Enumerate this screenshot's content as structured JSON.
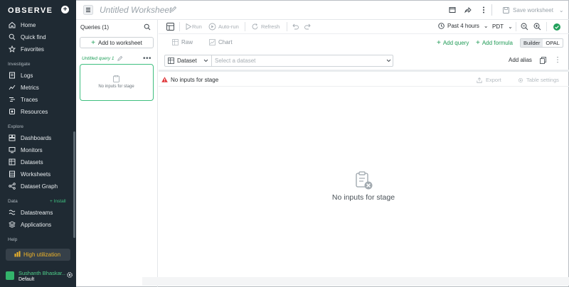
{
  "app": {
    "logo": "OBSERVE"
  },
  "sidebar": {
    "top_items": [
      {
        "label": "Home",
        "icon": "home-icon"
      },
      {
        "label": "Quick find",
        "icon": "search-icon"
      },
      {
        "label": "Favorites",
        "icon": "star-icon"
      }
    ],
    "sections": {
      "investigate": "Investigate",
      "explore": "Explore",
      "data": "Data",
      "help": "Help"
    },
    "investigate_items": [
      {
        "label": "Logs",
        "icon": "logs-icon"
      },
      {
        "label": "Metrics",
        "icon": "metrics-icon"
      },
      {
        "label": "Traces",
        "icon": "traces-icon"
      },
      {
        "label": "Resources",
        "icon": "resources-icon"
      }
    ],
    "explore_items": [
      {
        "label": "Dashboards",
        "icon": "dashboards-icon"
      },
      {
        "label": "Monitors",
        "icon": "monitors-icon"
      },
      {
        "label": "Datasets",
        "icon": "datasets-icon"
      },
      {
        "label": "Worksheets",
        "icon": "worksheets-icon"
      },
      {
        "label": "Dataset Graph",
        "icon": "graph-icon"
      }
    ],
    "data_items": [
      {
        "label": "Datastreams",
        "icon": "datastreams-icon"
      },
      {
        "label": "Applications",
        "icon": "applications-icon"
      }
    ],
    "install_link": "+ Install",
    "high_utilization": "High utilization",
    "user": {
      "name": "Sushanth Bhaskar...",
      "workspace": "Default"
    }
  },
  "topbar": {
    "title": "Untitled Worksheet",
    "save_label": "Save worksheet"
  },
  "queries": {
    "header": "Queries (1)",
    "add_to_worksheet": "Add to worksheet",
    "query_label": "Untitled query 1",
    "card_text": "No inputs for stage"
  },
  "toolbar": {
    "run": "Run",
    "autorun": "Auto-run",
    "refresh": "Refresh",
    "time_range": "Past 4 hours",
    "timezone": "PDT",
    "raw": "Raw",
    "chart": "Chart",
    "add_query": "Add query",
    "add_formula": "Add formula",
    "builder": "Builder",
    "opal": "OPAL"
  },
  "dataset_row": {
    "label": "Dataset",
    "placeholder": "Select a dataset",
    "add_alias": "Add alias"
  },
  "stage": {
    "error": "No inputs for stage",
    "export": "Export",
    "table_settings": "Table settings",
    "empty_text": "No inputs for stage"
  },
  "colors": {
    "sidebar_bg": "#1f2a33",
    "accent_green": "#22a05b",
    "warning_red": "#e0383b",
    "high_util_text": "#f0b429"
  }
}
